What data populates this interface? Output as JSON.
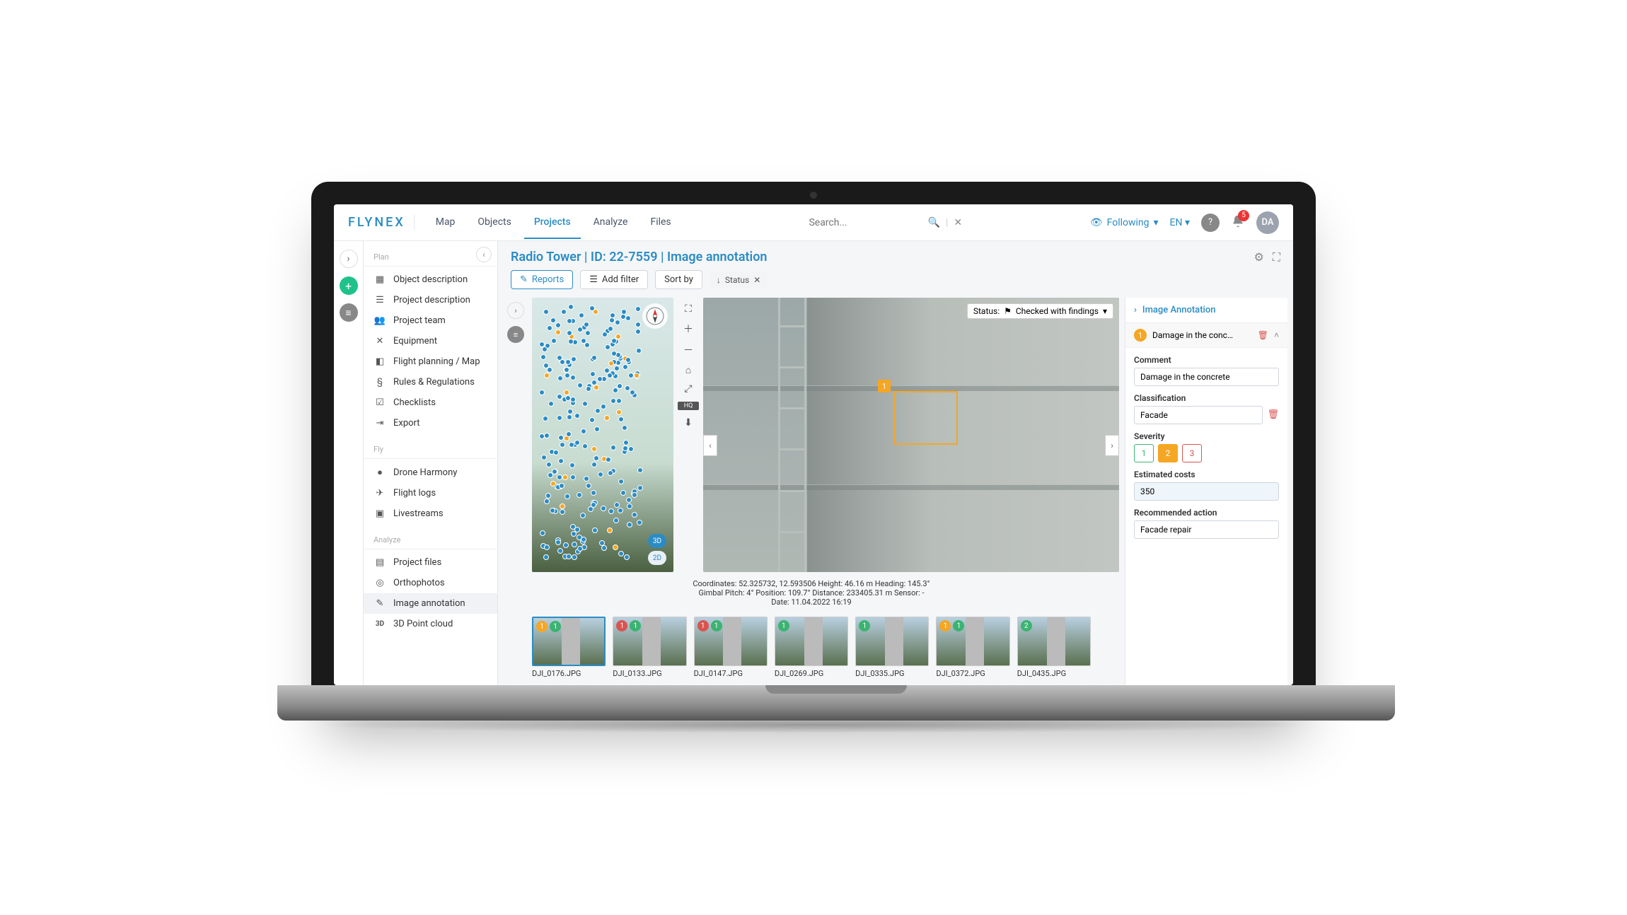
{
  "brand": "FLYNEX",
  "nav": {
    "map": "Map",
    "objects": "Objects",
    "projects": "Projects",
    "analyze": "Analyze",
    "files": "Files"
  },
  "search": {
    "placeholder": "Search..."
  },
  "following": "Following",
  "lang": "EN",
  "notif_count": "5",
  "user_initials": "DA",
  "sidebar": {
    "plan_label": "Plan",
    "fly_label": "Fly",
    "analyze_label": "Analyze",
    "plan": [
      "Object description",
      "Project description",
      "Project team",
      "Equipment",
      "Flight planning / Map",
      "Rules & Regulations",
      "Checklists",
      "Export"
    ],
    "fly": [
      "Drone Harmony",
      "Flight logs",
      "Livestreams"
    ],
    "analyze": [
      "Project files",
      "Orthophotos",
      "Image annotation",
      "3D Point cloud"
    ]
  },
  "page_title": "Radio Tower | ID: 22-7559 | Image annotation",
  "toolbar": {
    "reports": "Reports",
    "add_filter": "Add filter",
    "sort_by": "Sort by",
    "chip_status": "Status"
  },
  "status": {
    "label": "Status:",
    "value": "Checked with findings"
  },
  "pc": {
    "t3d": "3D",
    "t2d": "2D"
  },
  "meta": {
    "line1": "Coordinates: 52.325732, 12.593506   Height: 46.16 m   Heading: 145.3°",
    "line2": "Gimbal Pitch: 4°   Position: 109.7°   Distance: 233405.31 m   Sensor: -",
    "line3": "Date: 11.04.2022 16:19"
  },
  "thumbs": [
    {
      "name": "DJI_0176.JPG",
      "b": [
        [
          "1",
          "b-or"
        ],
        [
          "1",
          "b-gr"
        ]
      ],
      "sel": true
    },
    {
      "name": "DJI_0133.JPG",
      "b": [
        [
          "1",
          "b-rd"
        ],
        [
          "1",
          "b-gr"
        ]
      ]
    },
    {
      "name": "DJI_0147.JPG",
      "b": [
        [
          "1",
          "b-rd"
        ],
        [
          "1",
          "b-gr"
        ]
      ]
    },
    {
      "name": "DJI_0269.JPG",
      "b": [
        [
          "1",
          "b-gr"
        ]
      ]
    },
    {
      "name": "DJI_0335.JPG",
      "b": [
        [
          "1",
          "b-gr"
        ]
      ]
    },
    {
      "name": "DJI_0372.JPG",
      "b": [
        [
          "1",
          "b-or"
        ],
        [
          "1",
          "b-gr"
        ]
      ]
    },
    {
      "name": "DJI_0435.JPG",
      "b": [
        [
          "2",
          "b-gr"
        ]
      ]
    }
  ],
  "rpanel": {
    "title": "Image Annotation",
    "finding_num": "1",
    "finding_title": "Damage in the conc…",
    "comment_label": "Comment",
    "comment": "Damage in the concrete",
    "class_label": "Classification",
    "class": "Facade",
    "sev_label": "Severity",
    "sev": [
      "1",
      "2",
      "3"
    ],
    "cost_label": "Estimated costs",
    "cost": "350",
    "action_label": "Recommended action",
    "action": "Facade repair"
  }
}
